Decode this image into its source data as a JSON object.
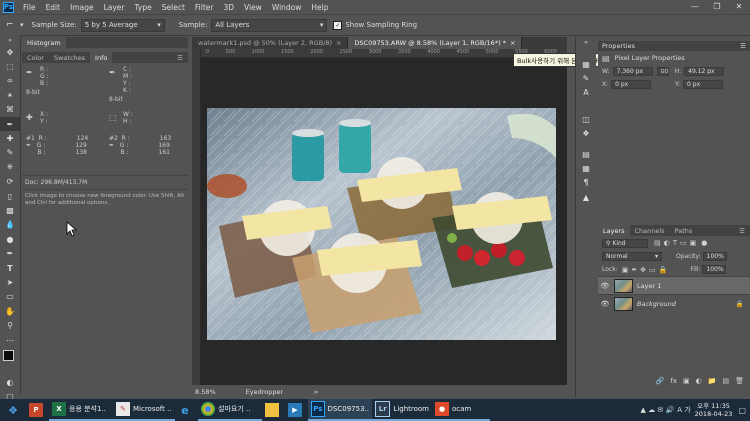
{
  "menu": {
    "items": [
      "File",
      "Edit",
      "Image",
      "Layer",
      "Type",
      "Select",
      "Filter",
      "3D",
      "View",
      "Window",
      "Help"
    ]
  },
  "options": {
    "sample_size_label": "Sample Size:",
    "sample_size_value": "5 by 5 Average",
    "sample_label": "Sample:",
    "sample_value": "All Layers",
    "show_ring_label": "Show Sampling Ring"
  },
  "left_panel": {
    "title": "Histogram",
    "tabs": [
      "Color",
      "Swatches",
      "Info"
    ],
    "info_rgb_left": [
      "R :",
      "G :",
      "B :"
    ],
    "info_cmyk_right": [
      "C :",
      "M :",
      "Y :",
      "K :"
    ],
    "info_bit_left": "8-bit",
    "info_bit_right": "8-bit",
    "xy_left": [
      "X :",
      "Y :"
    ],
    "wh_right": [
      "W :",
      "H :"
    ],
    "sample1": {
      "label": "#1",
      "r": "124",
      "g": "129",
      "b": "138"
    },
    "sample2": {
      "label": "#2",
      "r": "163",
      "g": "169",
      "b": "161"
    },
    "doc": "Doc: 296.8M/413.7M",
    "help": "Click image to choose new foreground color. Use Shift, Alt and Ctrl for additional options."
  },
  "doc_tabs": [
    {
      "label": "watermark1.psd @ 50% (Layer 2, RGB/8)",
      "close": "×"
    },
    {
      "label": "DSC09753.ARW @ 8.58% (Layer 1, RGB/16*) *",
      "close": "×"
    }
  ],
  "ruler_labels": [
    "0",
    "500",
    "1000",
    "1500",
    "2000",
    "2500",
    "3000",
    "3500",
    "4000",
    "4500",
    "5000",
    "5500",
    "6000"
  ],
  "tooltip": "Bulk사용하기 위해 본 설정 (F5)",
  "status": {
    "zoom": "8.58%",
    "tool": "Eyedropper",
    "arrow": ">"
  },
  "properties": {
    "tab": "Properties",
    "title": "Pixel Layer Properties",
    "w_label": "W:",
    "w": "7.360 px",
    "go": "GO",
    "h_label": "H:",
    "h": "49.12 px",
    "x_label": "X:",
    "x": "0 px",
    "y_label": "Y:",
    "y": "0 px"
  },
  "layers": {
    "tabs": [
      "Layers",
      "Channels",
      "Paths"
    ],
    "kind": "Kind",
    "blend": "Normal",
    "opacity_label": "Opacity:",
    "opacity": "100%",
    "lock_label": "Lock:",
    "fill_label": "Fill:",
    "fill": "100%",
    "rows": [
      {
        "name": "Layer 1",
        "selected": true
      },
      {
        "name": "Background",
        "selected": false
      }
    ]
  },
  "taskbar": {
    "items": [
      {
        "label": "",
        "icon": "windows-start-icon"
      },
      {
        "label": "",
        "icon": "powerpoint-icon"
      },
      {
        "label": "응용 분석1..",
        "icon": "excel-icon"
      },
      {
        "label": "Microsoft ..",
        "icon": "paint-icon"
      },
      {
        "label": "",
        "icon": "ie-icon"
      },
      {
        "label": "설마요기 ..",
        "icon": "chrome-icon"
      },
      {
        "label": "",
        "icon": "explorer-icon"
      },
      {
        "label": "",
        "icon": "media-icon"
      },
      {
        "label": "DSC09753..",
        "icon": "photoshop-icon"
      },
      {
        "label": "Lightroom",
        "icon": "lightroom-icon"
      },
      {
        "label": "ocam",
        "icon": "ocam-icon"
      }
    ],
    "time": "오후 11:35",
    "date": "2018-04-23",
    "lang": "A 가"
  },
  "colors": {
    "ps_blue": "#31a8ff",
    "panel": "#535353",
    "canvas_bg": "#282828",
    "taskbar": "#1c2b3a"
  }
}
